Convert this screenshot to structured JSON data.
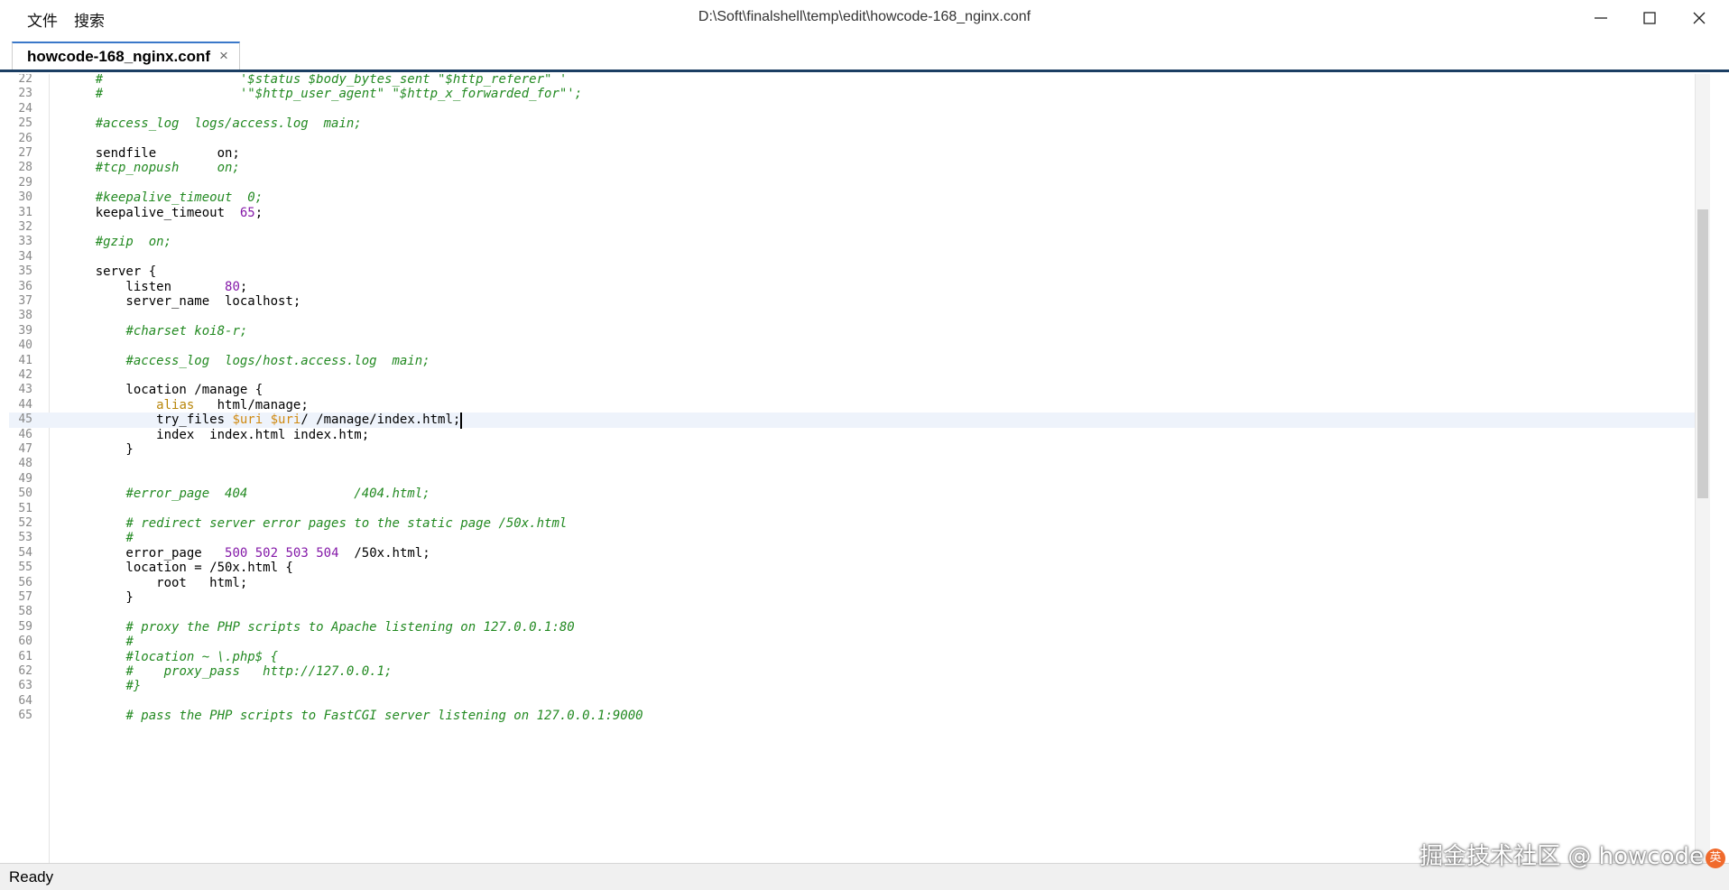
{
  "menu": {
    "file": "文件",
    "search": "搜索"
  },
  "window": {
    "title": "D:\\Soft\\finalshell\\temp\\edit\\howcode-168_nginx.conf"
  },
  "tab": {
    "label": "howcode-168_nginx.conf",
    "close": "×"
  },
  "status": {
    "text": "Ready"
  },
  "watermark": "掘金技术社区 @ howcode",
  "ime": "英",
  "editor": {
    "current_line": 45,
    "lines": [
      {
        "n": "22",
        "segs": [
          [
            "    ",
            ""
          ],
          [
            "#                  '$status $body_bytes_sent \"$http_referer\" '",
            "c-comment"
          ]
        ]
      },
      {
        "n": "23",
        "segs": [
          [
            "    ",
            ""
          ],
          [
            "#                  '\"$http_user_agent\" \"$http_x_forwarded_for\"';",
            "c-comment"
          ]
        ]
      },
      {
        "n": "24",
        "segs": []
      },
      {
        "n": "25",
        "segs": [
          [
            "    ",
            ""
          ],
          [
            "#access_log  logs/access.log  main;",
            "c-comment"
          ]
        ]
      },
      {
        "n": "26",
        "segs": []
      },
      {
        "n": "27",
        "segs": [
          [
            "    sendfile        on;",
            ""
          ]
        ]
      },
      {
        "n": "28",
        "segs": [
          [
            "    ",
            ""
          ],
          [
            "#tcp_nopush     on;",
            "c-comment"
          ]
        ]
      },
      {
        "n": "29",
        "segs": []
      },
      {
        "n": "30",
        "segs": [
          [
            "    ",
            ""
          ],
          [
            "#keepalive_timeout  0;",
            "c-comment"
          ]
        ]
      },
      {
        "n": "31",
        "segs": [
          [
            "    keepalive_timeout  ",
            ""
          ],
          [
            "65",
            "c-num"
          ],
          [
            ";",
            ""
          ]
        ]
      },
      {
        "n": "32",
        "segs": []
      },
      {
        "n": "33",
        "segs": [
          [
            "    ",
            ""
          ],
          [
            "#gzip  on;",
            "c-comment"
          ]
        ]
      },
      {
        "n": "34",
        "segs": []
      },
      {
        "n": "35",
        "segs": [
          [
            "    server {",
            ""
          ]
        ]
      },
      {
        "n": "36",
        "segs": [
          [
            "        listen       ",
            ""
          ],
          [
            "80",
            "c-num"
          ],
          [
            ";",
            ""
          ]
        ]
      },
      {
        "n": "37",
        "segs": [
          [
            "        server_name  localhost;",
            ""
          ]
        ]
      },
      {
        "n": "38",
        "segs": []
      },
      {
        "n": "39",
        "segs": [
          [
            "        ",
            ""
          ],
          [
            "#charset koi8-r;",
            "c-comment"
          ]
        ]
      },
      {
        "n": "40",
        "segs": []
      },
      {
        "n": "41",
        "segs": [
          [
            "        ",
            ""
          ],
          [
            "#access_log  logs/host.access.log  main;",
            "c-comment"
          ]
        ]
      },
      {
        "n": "42",
        "segs": []
      },
      {
        "n": "43",
        "segs": [
          [
            "        location /manage {",
            ""
          ]
        ]
      },
      {
        "n": "44",
        "segs": [
          [
            "            ",
            ""
          ],
          [
            "alias",
            "c-kw"
          ],
          [
            "   html/manage;",
            ""
          ]
        ]
      },
      {
        "n": "45",
        "segs": [
          [
            "            try_files ",
            ""
          ],
          [
            "$uri",
            "c-var"
          ],
          [
            " ",
            ""
          ],
          [
            "$uri",
            "c-var"
          ],
          [
            "/ /manage/index.html;",
            ""
          ]
        ]
      },
      {
        "n": "46",
        "segs": [
          [
            "            index  index.html index.htm;",
            ""
          ]
        ]
      },
      {
        "n": "47",
        "segs": [
          [
            "        }",
            ""
          ]
        ]
      },
      {
        "n": "48",
        "segs": []
      },
      {
        "n": "49",
        "segs": []
      },
      {
        "n": "50",
        "segs": [
          [
            "        ",
            ""
          ],
          [
            "#error_page  404              /404.html;",
            "c-comment"
          ]
        ]
      },
      {
        "n": "51",
        "segs": []
      },
      {
        "n": "52",
        "segs": [
          [
            "        ",
            ""
          ],
          [
            "# redirect server error pages to the static page /50x.html",
            "c-comment"
          ]
        ]
      },
      {
        "n": "53",
        "segs": [
          [
            "        ",
            ""
          ],
          [
            "#",
            "c-comment"
          ]
        ]
      },
      {
        "n": "54",
        "segs": [
          [
            "        error_page   ",
            ""
          ],
          [
            "500",
            "c-num"
          ],
          [
            " ",
            ""
          ],
          [
            "502",
            "c-num"
          ],
          [
            " ",
            ""
          ],
          [
            "503",
            "c-num"
          ],
          [
            " ",
            ""
          ],
          [
            "504",
            "c-num"
          ],
          [
            "  /50x.html;",
            ""
          ]
        ]
      },
      {
        "n": "55",
        "segs": [
          [
            "        location = /50x.html {",
            ""
          ]
        ]
      },
      {
        "n": "56",
        "segs": [
          [
            "            root   html;",
            ""
          ]
        ]
      },
      {
        "n": "57",
        "segs": [
          [
            "        }",
            ""
          ]
        ]
      },
      {
        "n": "58",
        "segs": []
      },
      {
        "n": "59",
        "segs": [
          [
            "        ",
            ""
          ],
          [
            "# proxy the PHP scripts to Apache listening on 127.0.0.1:80",
            "c-comment"
          ]
        ]
      },
      {
        "n": "60",
        "segs": [
          [
            "        ",
            ""
          ],
          [
            "#",
            "c-comment"
          ]
        ]
      },
      {
        "n": "61",
        "segs": [
          [
            "        ",
            ""
          ],
          [
            "#location ~ \\.php$ {",
            "c-comment"
          ]
        ]
      },
      {
        "n": "62",
        "segs": [
          [
            "        ",
            ""
          ],
          [
            "#    proxy_pass   http://127.0.0.1;",
            "c-comment"
          ]
        ]
      },
      {
        "n": "63",
        "segs": [
          [
            "        ",
            ""
          ],
          [
            "#}",
            "c-comment"
          ]
        ]
      },
      {
        "n": "64",
        "segs": []
      },
      {
        "n": "65",
        "segs": [
          [
            "        ",
            ""
          ],
          [
            "# pass the PHP scripts to FastCGI server listening on 127.0.0.1:9000",
            "c-comment"
          ]
        ]
      }
    ]
  }
}
